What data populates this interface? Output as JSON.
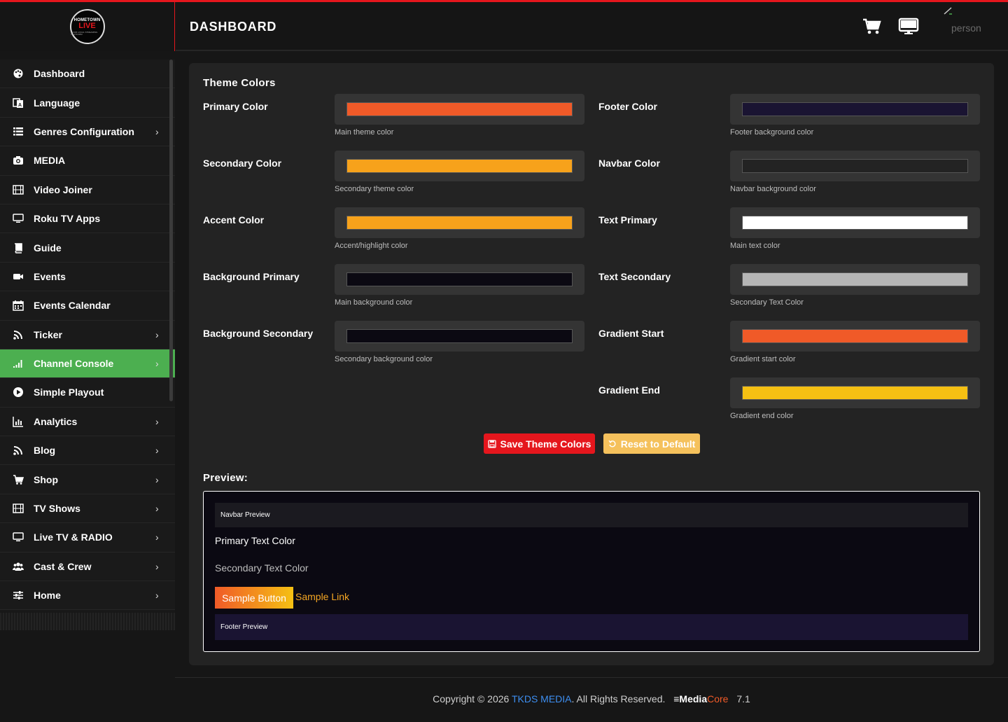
{
  "logo": {
    "line1": "HOMETOWN",
    "line2": "LIVE",
    "line3": "YOUR LOCAL STREAMING PLATFORM"
  },
  "header": {
    "title": "DASHBOARD",
    "user": "person",
    "icons": [
      "cart-icon",
      "monitor-icon",
      "pencil-icon"
    ]
  },
  "sidebar": {
    "items": [
      {
        "label": "Dashboard",
        "icon": "palette-icon",
        "chevron": false,
        "active": false
      },
      {
        "label": "Language",
        "icon": "language-icon",
        "chevron": false,
        "active": false
      },
      {
        "label": "Genres Configuration",
        "icon": "list-icon",
        "chevron": true,
        "active": false
      },
      {
        "label": "MEDIA",
        "icon": "camera-icon",
        "chevron": false,
        "active": false
      },
      {
        "label": "Video Joiner",
        "icon": "film-icon",
        "chevron": false,
        "active": false
      },
      {
        "label": "Roku TV Apps",
        "icon": "monitor-icon",
        "chevron": false,
        "active": false
      },
      {
        "label": "Guide",
        "icon": "book-icon",
        "chevron": false,
        "active": false
      },
      {
        "label": "Events",
        "icon": "video-icon",
        "chevron": false,
        "active": false
      },
      {
        "label": "Events Calendar",
        "icon": "calendar-icon",
        "chevron": false,
        "active": false
      },
      {
        "label": "Ticker",
        "icon": "rss-icon",
        "chevron": true,
        "active": false
      },
      {
        "label": "Channel Console",
        "icon": "signal-icon",
        "chevron": true,
        "active": true
      },
      {
        "label": "Simple Playout",
        "icon": "play-circle-icon",
        "chevron": false,
        "active": false
      },
      {
        "label": "Analytics",
        "icon": "bar-chart-icon",
        "chevron": true,
        "active": false
      },
      {
        "label": "Blog",
        "icon": "rss-icon",
        "chevron": true,
        "active": false
      },
      {
        "label": "Shop",
        "icon": "cart-icon",
        "chevron": true,
        "active": false
      },
      {
        "label": "TV Shows",
        "icon": "film-icon",
        "chevron": true,
        "active": false
      },
      {
        "label": "Live TV & RADIO",
        "icon": "monitor-icon",
        "chevron": true,
        "active": false
      },
      {
        "label": "Cast & Crew",
        "icon": "users-icon",
        "chevron": true,
        "active": false
      },
      {
        "label": "Home",
        "icon": "sliders-icon",
        "chevron": true,
        "active": false
      }
    ],
    "chevron_glyph": "›"
  },
  "theme": {
    "title": "Theme Colors",
    "left": [
      {
        "label": "Primary Color",
        "help": "Main theme color",
        "color": "#f05a28"
      },
      {
        "label": "Secondary Color",
        "help": "Secondary theme color",
        "color": "#f7a21b"
      },
      {
        "label": "Accent Color",
        "help": "Accent/highlight color",
        "color": "#f7a21b"
      },
      {
        "label": "Background Primary",
        "help": "Main background color",
        "color": "#0b0912"
      },
      {
        "label": "Background Secondary",
        "help": "Secondary background color",
        "color": "#0b0912"
      }
    ],
    "right": [
      {
        "label": "Footer Color",
        "help": "Footer background color",
        "color": "#1a1432"
      },
      {
        "label": "Navbar Color",
        "help": "Navbar background color",
        "color": "#232323"
      },
      {
        "label": "Text Primary",
        "help": "Main text color",
        "color": "#ffffff"
      },
      {
        "label": "Text Secondary",
        "help": "Secondary Text Color",
        "color": "#b5b5b5"
      },
      {
        "label": "Gradient Start",
        "help": "Gradient start color",
        "color": "#f05a28"
      },
      {
        "label": "Gradient End",
        "help": "Gradient end color",
        "color": "#f5c013"
      }
    ],
    "save_label": "Save Theme Colors",
    "reset_label": "Reset to Default"
  },
  "preview": {
    "title": "Preview:",
    "navbar": "Navbar Preview",
    "primary_text": "Primary Text Color",
    "secondary_text": "Secondary Text Color",
    "button": "Sample Button",
    "link": "Sample Link",
    "footer": "Footer Preview"
  },
  "footer": {
    "prefix": "Copyright © 2026",
    "company": "TKDS MEDIA",
    "suffix": ". All Rights Reserved.",
    "brand_main": "≡Media",
    "brand_core": "Core",
    "version": "7.1"
  }
}
